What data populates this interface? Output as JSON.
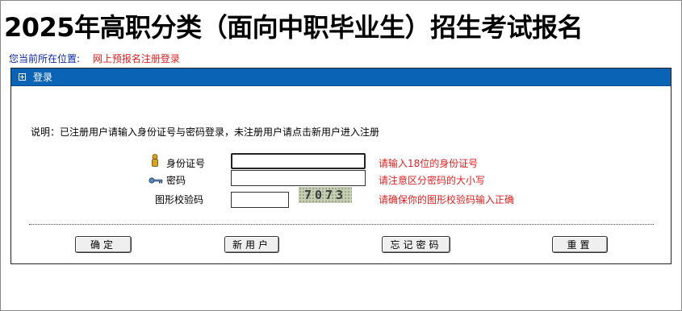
{
  "header": {
    "title": "2025年高职分类（面向中职毕业生）招生考试报名"
  },
  "location": {
    "label": "您当前所在位置:",
    "value": "网上预报名注册登录"
  },
  "panel": {
    "title": "登录",
    "description": "说明：已注册用户请输入身份证号与密码登录，未注册用户请点击新用户进入注册"
  },
  "form": {
    "id_label": "身份证号",
    "id_value": "",
    "id_hint": "请输入18位的身份证号",
    "password_label": "密码",
    "password_value": "",
    "password_hint": "请注意区分密码的大小写",
    "captcha_label": "图形校验码",
    "captcha_value": "",
    "captcha_image_text": "7073",
    "captcha_hint": "请确保你的图形校验码输入正确"
  },
  "buttons": {
    "confirm": "确定",
    "new_user": "新用户",
    "forgot_password": "忘记密码",
    "reset": "重置"
  },
  "colors": {
    "panel_header": "#0b63b6",
    "hint_text": "#e02020",
    "location_label": "#0b27a8"
  },
  "icons": {
    "id": "person-icon",
    "password": "key-icon",
    "panel": "expand-box-icon"
  }
}
